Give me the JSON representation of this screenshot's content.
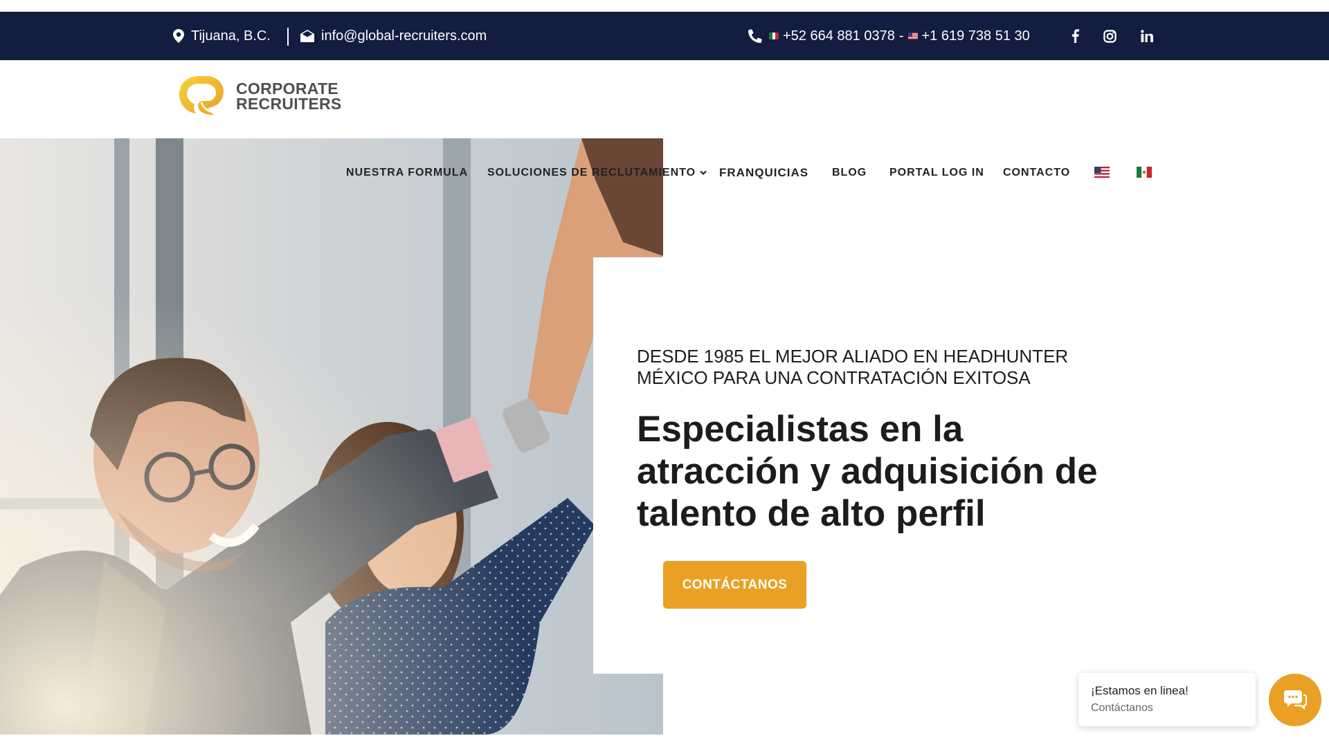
{
  "topbar": {
    "location": "Tijuana, B.C.",
    "email": "info@global-recruiters.com",
    "phone_mx": "+52 664 881 0378",
    "phone_separator": "-",
    "phone_us": "+1 619 738 51 30",
    "social": [
      "facebook-icon",
      "instagram-icon",
      "linkedin-icon"
    ],
    "bg_color": "#121d3f"
  },
  "logo": {
    "line1": "CORPORATE",
    "line2": "RECRUITERS"
  },
  "nav": {
    "items": [
      {
        "label": "NUESTRA FORMULA"
      },
      {
        "label": "SOLUCIONES DE RECLUTAMIENTO",
        "has_dropdown": true
      },
      {
        "label": "FRANQUICIAS"
      },
      {
        "label": "BLOG"
      },
      {
        "label": "PORTAL LOG IN"
      },
      {
        "label": "CONTACTO"
      }
    ],
    "languages": [
      "us-flag-icon",
      "mx-flag-icon"
    ]
  },
  "hero": {
    "eyebrow": "DESDE 1985 EL MEJOR ALIADO EN HEADHUNTER MÉXICO PARA UNA CONTRATACIÓN EXITOSA",
    "headline": "Especialistas en la atracción y adquisición de talento de alto perfil",
    "cta_label": "CONTÁCTANOS",
    "accent_color": "#e9a024"
  },
  "chat": {
    "title": "¡Estamos en linea!",
    "subtitle": "Contáctanos"
  }
}
